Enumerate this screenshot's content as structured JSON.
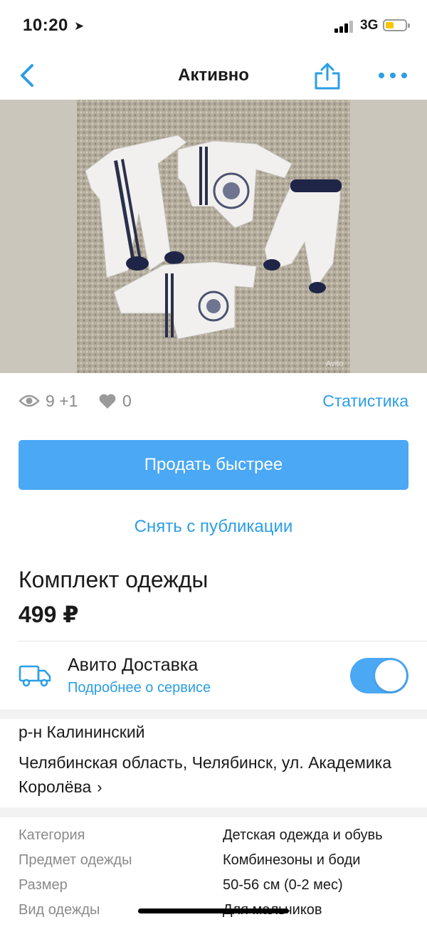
{
  "status_bar": {
    "time": "10:20",
    "network": "3G"
  },
  "nav": {
    "title": "Активно"
  },
  "photo": {
    "watermark": "Avito"
  },
  "stats": {
    "views": "9 +1",
    "favorites": "0",
    "statistics_link": "Статистика"
  },
  "actions": {
    "sell_faster": "Продать быстрее",
    "unpublish": "Снять с публикации"
  },
  "listing": {
    "title": "Комплект одежды",
    "price": "499 ₽"
  },
  "delivery": {
    "title": "Авито Доставка",
    "link": "Подробнее о сервисе",
    "enabled": true
  },
  "location": {
    "district": "р-н Калининский",
    "address": "Челябинская область, Челябинск, ул. Академика Королёва"
  },
  "params": [
    {
      "key": "Категория",
      "value": "Детская одежда и обувь"
    },
    {
      "key": "Предмет одежды",
      "value": "Комбинезоны и боди"
    },
    {
      "key": "Размер",
      "value": "50-56 см (0-2 мес)"
    },
    {
      "key": "Вид одежды",
      "value": "Для мальчиков"
    }
  ],
  "colors": {
    "accent": "#4aa8f5",
    "link": "#2b9ee6",
    "muted": "#8a8a8a"
  }
}
